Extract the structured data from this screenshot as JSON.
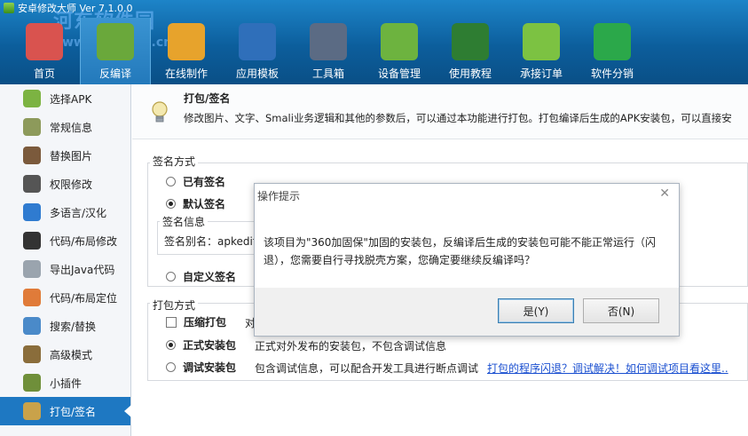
{
  "window": {
    "title": "安卓修改大师 Ver 7.1.0.0"
  },
  "watermark": {
    "text": "河东软件园",
    "url": "www.pc0359.cn"
  },
  "toolbar": [
    {
      "label": "首页",
      "icon": "house-icon",
      "color": "#d9534f"
    },
    {
      "label": "反编译",
      "icon": "android-chip-icon",
      "color": "#6aa83b",
      "active": true
    },
    {
      "label": "在线制作",
      "icon": "toolbox-icon",
      "color": "#e7a32c"
    },
    {
      "label": "应用模板",
      "icon": "star-icon",
      "color": "#2f6fba"
    },
    {
      "label": "工具箱",
      "icon": "gear-box-icon",
      "color": "#5b6b84"
    },
    {
      "label": "设备管理",
      "icon": "radar-icon",
      "color": "#6db33f"
    },
    {
      "label": "使用教程",
      "icon": "blackboard-icon",
      "color": "#2e7d32"
    },
    {
      "label": "承接订单",
      "icon": "shopping-bag-icon",
      "color": "#7cc242"
    },
    {
      "label": "软件分销",
      "icon": "dollar-icon",
      "color": "#2ba84a"
    }
  ],
  "sidebar": [
    {
      "label": "选择APK",
      "icon": "android-icon",
      "color": "#7cb342"
    },
    {
      "label": "常规信息",
      "icon": "android-info-icon",
      "color": "#8d9a5b"
    },
    {
      "label": "替换图片",
      "icon": "image-icon",
      "color": "#7b5a3c"
    },
    {
      "label": "权限修改",
      "icon": "lock-icon",
      "color": "#555555"
    },
    {
      "label": "多语言/汉化",
      "icon": "globe-icon",
      "color": "#2f7bd0"
    },
    {
      "label": "代码/布局修改",
      "icon": "terminal-icon",
      "color": "#333333"
    },
    {
      "label": "导出Java代码",
      "icon": "document-icon",
      "color": "#9aa4ae"
    },
    {
      "label": "代码/布局定位",
      "icon": "location-icon",
      "color": "#e07b39"
    },
    {
      "label": "搜索/替换",
      "icon": "magnifier-icon",
      "color": "#4a8ac9"
    },
    {
      "label": "高级模式",
      "icon": "tools-icon",
      "color": "#8a6d3b"
    },
    {
      "label": "小插件",
      "icon": "android-plugin-icon",
      "color": "#6f8f3a"
    },
    {
      "label": "打包/签名",
      "icon": "package-icon",
      "color": "#c9a24a",
      "active": true
    }
  ],
  "header": {
    "title": "打包/签名",
    "desc": "修改图片、文字、Smali业务逻辑和其他的参数后，可以通过本功能进行打包。打包编译后生成的APK安装包，可以直接安"
  },
  "sign": {
    "group_title": "签名方式",
    "opt_existing": "已有签名",
    "opt_default": "默认签名",
    "info_title": "签名信息",
    "alias_text": "签名别名：apkedit",
    "opt_custom": "自定义签名"
  },
  "pack": {
    "group_title": "打包方式",
    "compress_label": "压缩打包",
    "compress_desc": "对",
    "release_label": "正式安装包",
    "release_desc": "正式对外发布的安装包，不包含调试信息",
    "debug_label": "调试安装包",
    "debug_desc": "包含调试信息，可以配合开发工具进行断点调试",
    "debug_link": "打包的程序闪退？调试解决！如何调试项目看这里.."
  },
  "dialog": {
    "title": "操作提示",
    "message": "该项目为\"360加固保\"加固的安装包，反编译后生成的安装包可能不能正常运行（闪退），您需要自行寻找脱壳方案，您确定要继续反编译吗？",
    "yes": "是(Y)",
    "no": "否(N)"
  }
}
